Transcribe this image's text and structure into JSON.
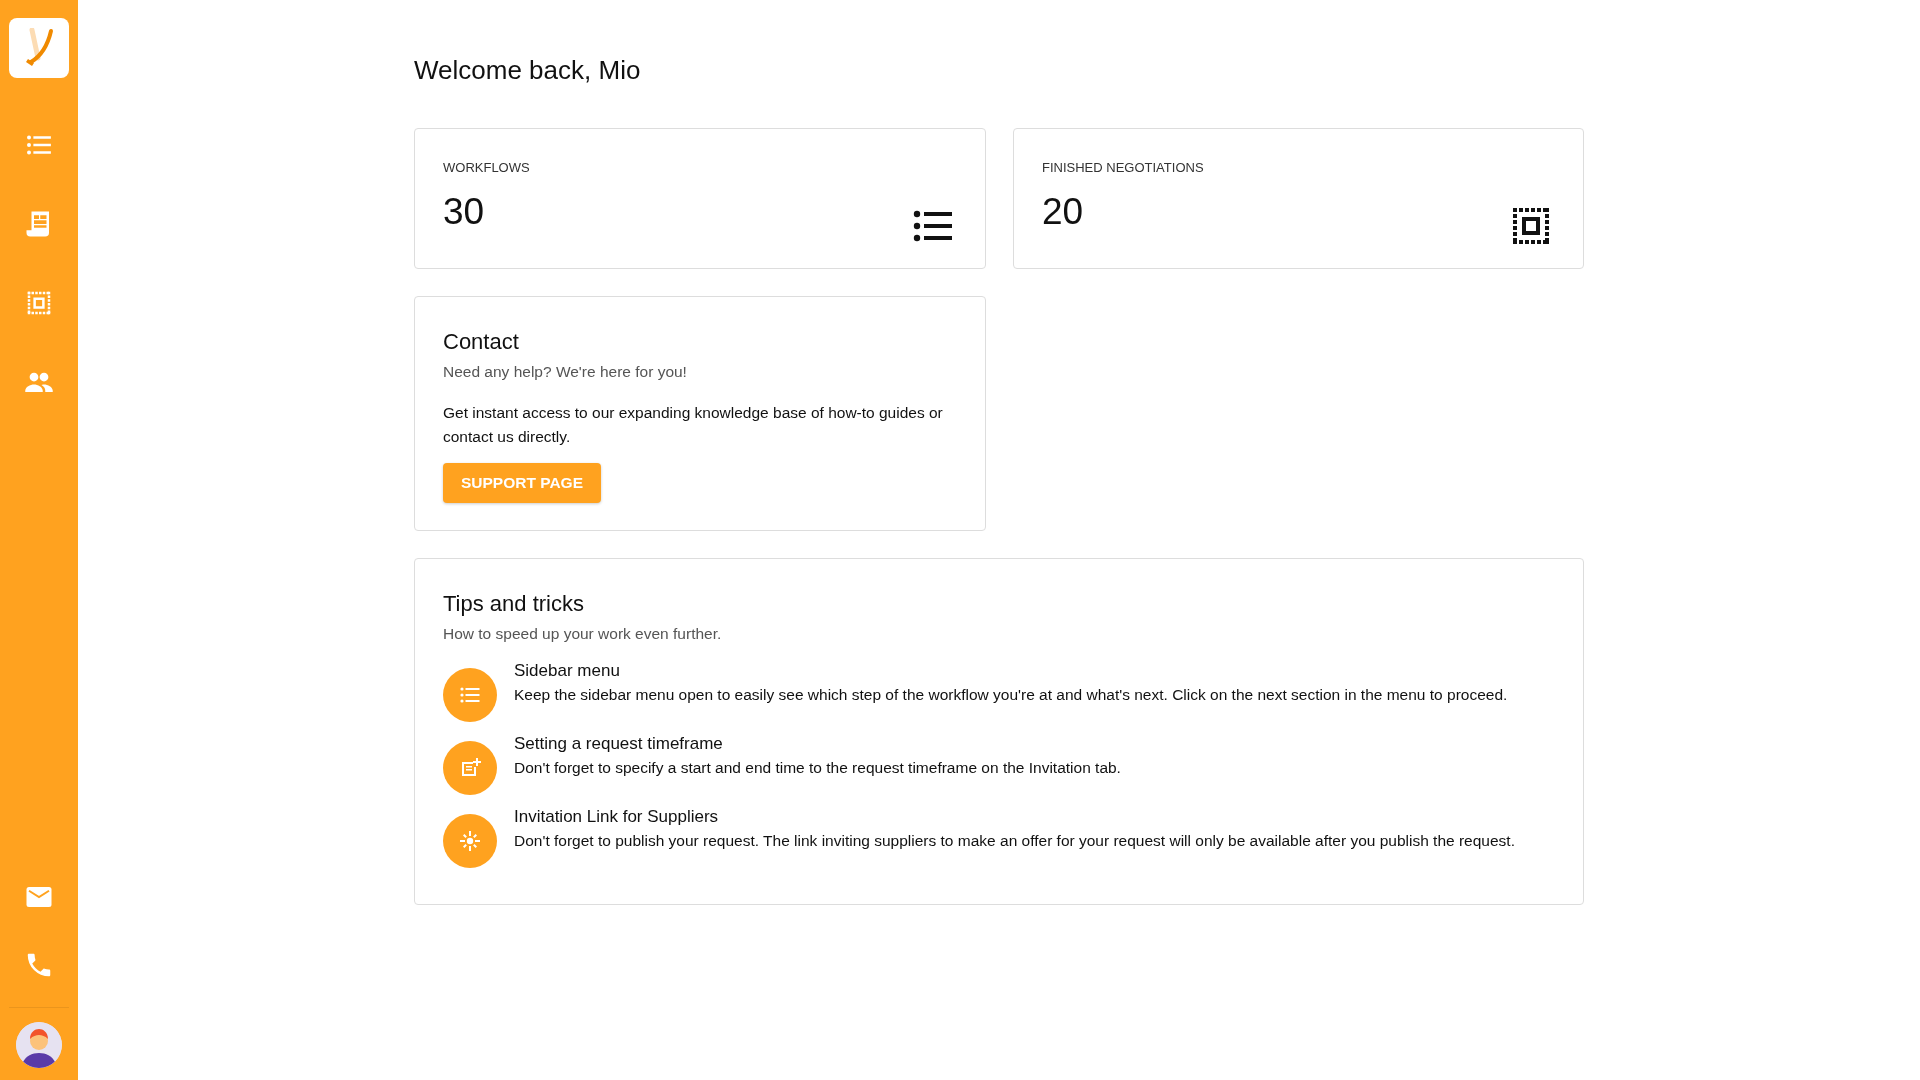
{
  "greeting": "Welcome back, Mio",
  "stats": [
    {
      "label": "WORKFLOWS",
      "value": "30"
    },
    {
      "label": "FINISHED NEGOTIATIONS",
      "value": "20"
    }
  ],
  "contact": {
    "title": "Contact",
    "subtitle": "Need any help? We're here for you!",
    "body": "Get instant access to our expanding knowledge base of how-to guides or contact us directly.",
    "button": "SUPPORT PAGE"
  },
  "tips": {
    "title": "Tips and tricks",
    "subtitle": "How to speed up your work even further.",
    "items": [
      {
        "title": "Sidebar menu",
        "text": "Keep the sidebar menu open to easily see which step of the workflow you're at and what's next. Click on the next section in the menu to proceed."
      },
      {
        "title": "Setting a request timeframe",
        "text": "Don't forget to specify a start and end time to the request timeframe on the Invitation tab."
      },
      {
        "title": "Invitation Link for Suppliers",
        "text": "Don't forget to publish your request. The link inviting suppliers to make an offer for your request will only be available after you publish the request."
      }
    ]
  }
}
